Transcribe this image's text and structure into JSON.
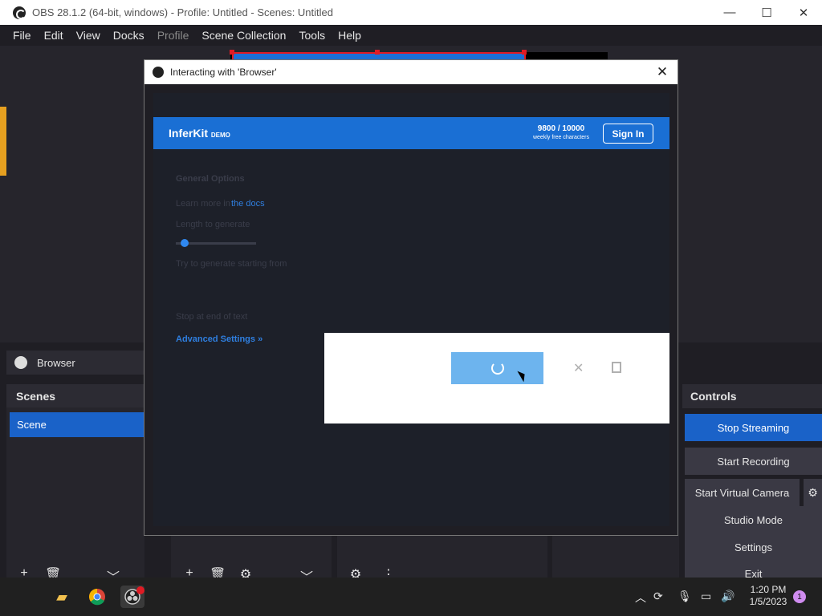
{
  "window": {
    "title": "OBS 28.1.2 (64-bit, windows) - Profile: Untitled - Scenes: Untitled",
    "minimize": "—",
    "maximize": "☐",
    "close": "✕"
  },
  "menu": [
    "File",
    "Edit",
    "View",
    "Docks",
    "Profile",
    "Scene Collection",
    "Tools",
    "Help"
  ],
  "source_bar": {
    "label": "Browser"
  },
  "scenes": {
    "title": "Scenes",
    "items": [
      "Scene"
    ]
  },
  "controls": {
    "title": "Controls",
    "stop_streaming": "Stop Streaming",
    "start_recording": "Start Recording",
    "start_virtual_camera": "Start Virtual Camera",
    "studio_mode": "Studio Mode",
    "settings": "Settings",
    "exit": "Exit"
  },
  "dialog": {
    "title": "Interacting with 'Browser'",
    "close": "✕"
  },
  "inferkit": {
    "brand": "InferKit",
    "brand_tag": "DEMO",
    "count": "9800 / 10000",
    "count_caption": "weekly free characters",
    "sign_in": "Sign In",
    "general_options": "General Options",
    "learn_more": "Learn more in",
    "docs_link": "the docs",
    "length_label": "Length to generate",
    "start_label": "Try to generate starting from",
    "stop_label": "Stop at end of text",
    "advanced": "Advanced Settings »"
  },
  "modal": {
    "dismiss": "✕"
  },
  "taskbar": {
    "time": "1:20 PM",
    "date": "1/5/2023",
    "notifications": "1"
  },
  "colors": {
    "accent": "#1a62c8",
    "inferkit_blue": "#1a6fd4",
    "submit_blue": "#6db4ee"
  }
}
